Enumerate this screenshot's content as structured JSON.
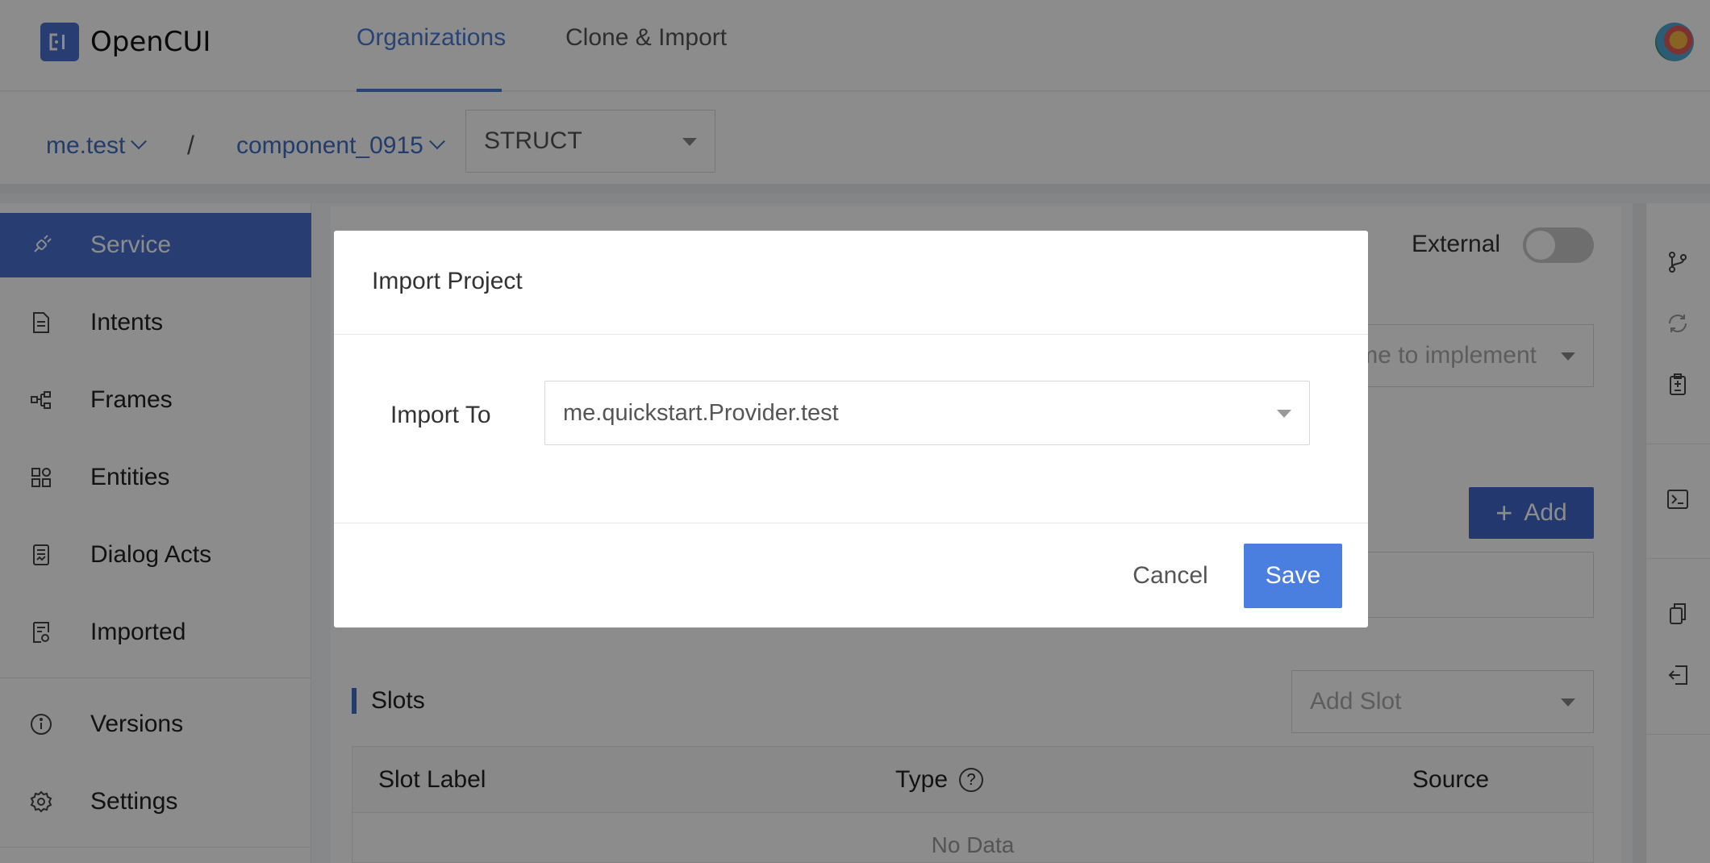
{
  "app": {
    "name": "OpenCUI",
    "logo_glyph": "ᴄı"
  },
  "header": {
    "tabs": [
      {
        "label": "Organizations",
        "active": true
      },
      {
        "label": "Clone & Import",
        "active": false
      }
    ]
  },
  "breadcrumb": {
    "org": "me.test",
    "separator": "/",
    "project": "component_0915",
    "type_select": "STRUCT"
  },
  "sidebar": {
    "items": [
      {
        "label": "Service",
        "icon": "plug-icon",
        "active": true
      },
      {
        "label": "Intents",
        "icon": "document-icon"
      },
      {
        "label": "Frames",
        "icon": "frames-icon"
      },
      {
        "label": "Entities",
        "icon": "entities-icon"
      },
      {
        "label": "Dialog Acts",
        "icon": "dialog-acts-icon"
      },
      {
        "label": "Imported",
        "icon": "imported-icon"
      },
      {
        "label": "Versions",
        "icon": "info-icon"
      },
      {
        "label": "Settings",
        "icon": "gear-icon"
      }
    ]
  },
  "main": {
    "external_label": "External",
    "external_enabled": false,
    "implement_placeholder": "me to implement",
    "add_button": "Add",
    "slots_title": "Slots",
    "add_slot_placeholder": "Add Slot",
    "table": {
      "columns": [
        "Slot Label",
        "Type",
        "Source"
      ],
      "empty_text": "No Data"
    }
  },
  "modal": {
    "title": "Import Project",
    "field_label": "Import To",
    "field_value": "me.quickstart.Provider.test",
    "cancel": "Cancel",
    "save": "Save"
  },
  "colors": {
    "primary": "#4a6fd0",
    "link": "#3e6fc4",
    "save_button": "#4a7fe0"
  }
}
